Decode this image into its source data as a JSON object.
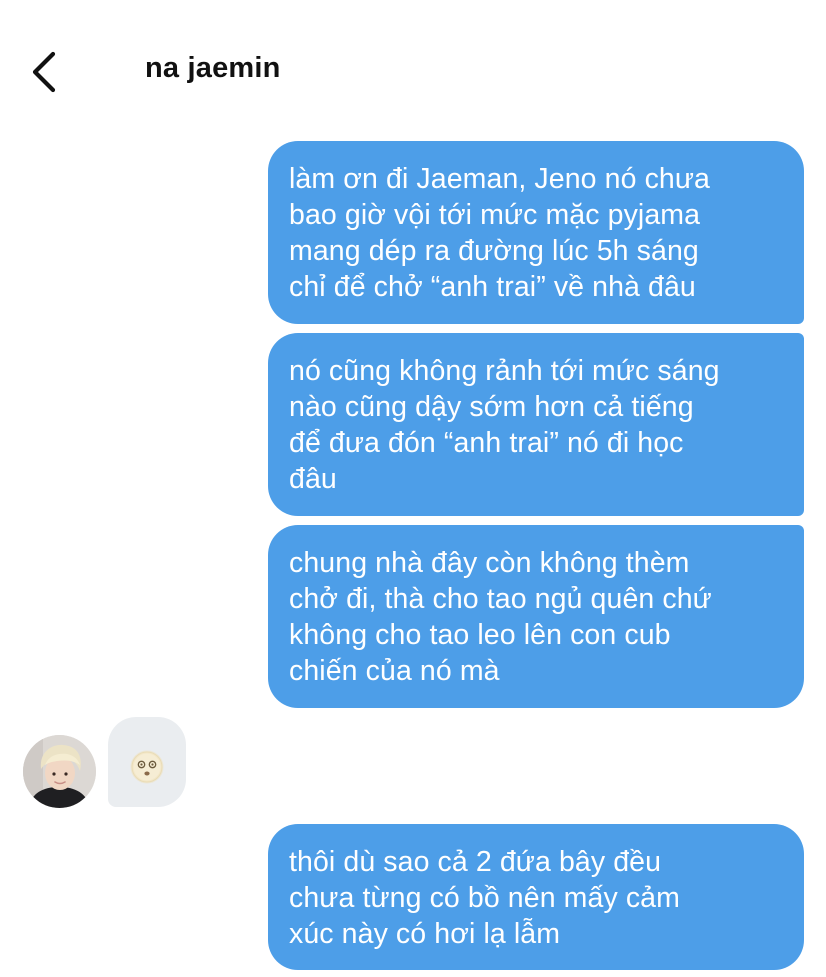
{
  "header": {
    "back_icon": "chevron-left-icon",
    "contact_name": "na jaemin"
  },
  "messages": [
    {
      "direction": "outgoing",
      "text": "làm ơn đi Jaeman, Jeno nó chưa\nbao giờ vội tới mức mặc pyjama\nmang dép ra đường lúc 5h sáng\nchỉ để chở “anh trai” về nhà đâu"
    },
    {
      "direction": "outgoing",
      "text": "nó cũng không rảnh tới mức sáng\nnào cũng dậy sớm hơn cả tiếng\nđể đưa đón “anh trai” nó đi học\nđâu"
    },
    {
      "direction": "outgoing",
      "text": "chung nhà đây còn không thèm\nchở đi, thà cho tao ngủ quên chứ\nkhông cho tao leo lên con cub\nchiến của nó mà"
    },
    {
      "direction": "incoming",
      "avatar": "contact-avatar",
      "emoji": "face-with-spiral-eyes-icon"
    },
    {
      "direction": "outgoing",
      "text": "thôi dù sao cả 2 đứa bây đều\nchưa từng có bồ nên mấy cảm\nxúc này có hơi lạ lẫm"
    }
  ],
  "colors": {
    "outgoing_bubble": "#4d9ee8",
    "incoming_bubble": "#eaedf0",
    "outgoing_text": "#ffffff",
    "title_text": "#111111"
  }
}
